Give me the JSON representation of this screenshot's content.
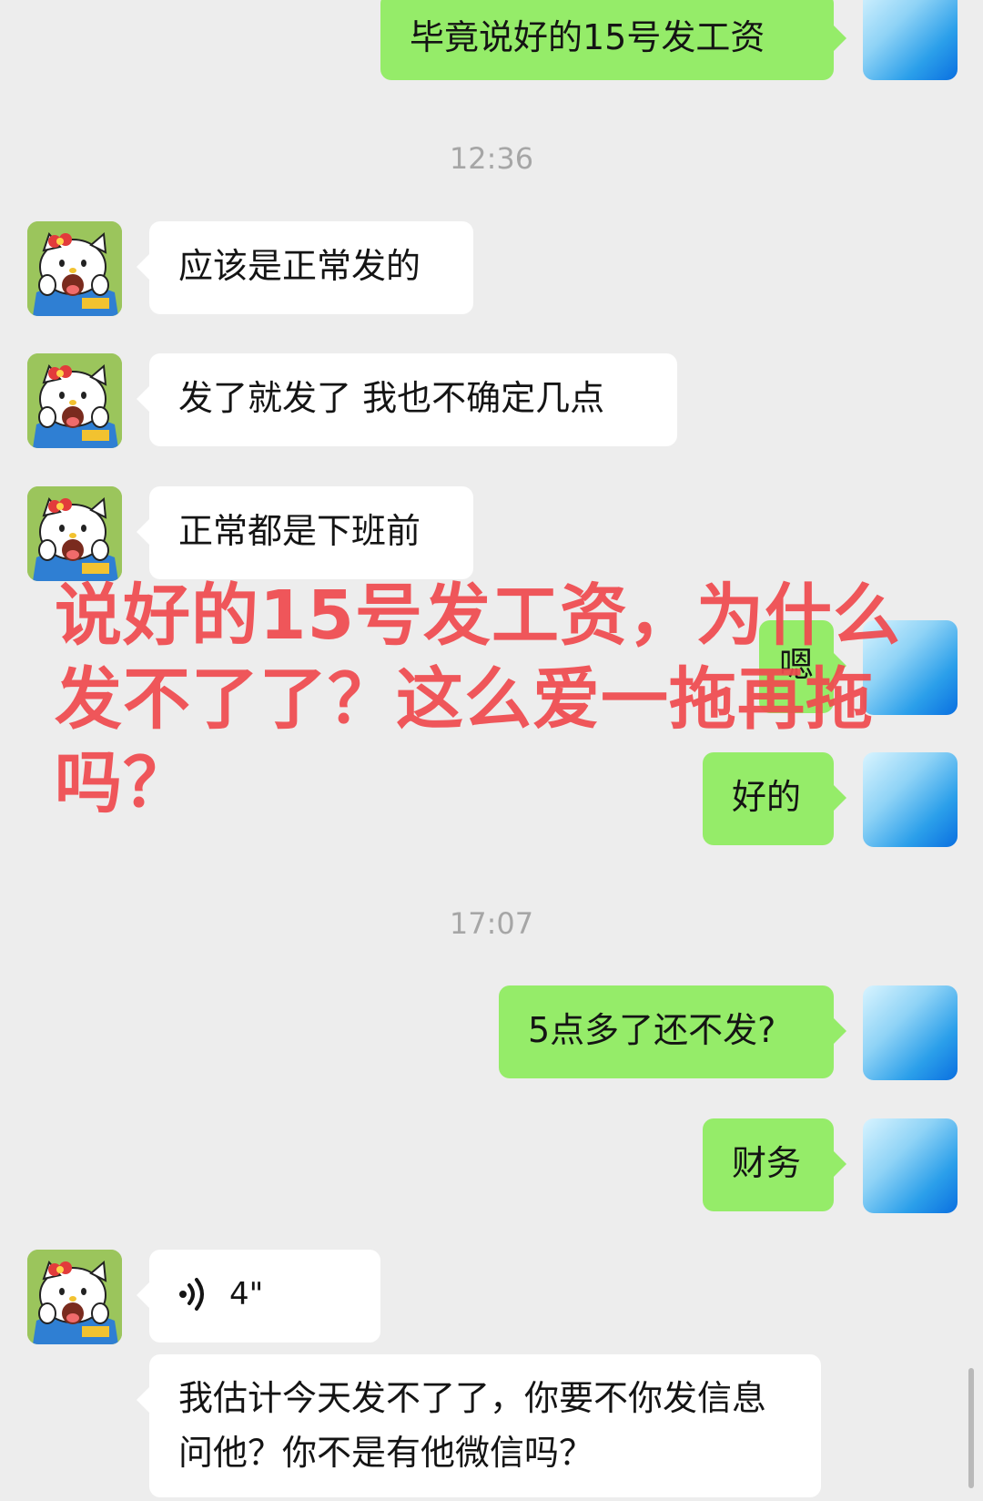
{
  "messages": {
    "m1": "毕竟说好的15号发工资",
    "t1": "12:36",
    "m2": "应该是正常发的",
    "m3": "发了就发了 我也不确定几点",
    "m4": "正常都是下班前",
    "m5": "嗯",
    "m6": "好的",
    "t2": "17:07",
    "m7": "5点多了还不发?",
    "m8": "财务",
    "voice_duration": "4\"",
    "m9": "我估计今天发不了了，你要不你发信息问他？你不是有他微信吗？"
  },
  "overlay_text": "说好的15号发工资，为什么发不了了？这么爱一拖再拖吗？",
  "colors": {
    "background": "#ededed",
    "outgoing_bubble": "#95ec69",
    "incoming_bubble": "#ffffff",
    "overlay_text": "#f04b4f",
    "timestamp": "#a6a6a6"
  },
  "icons": {
    "contact_avatar": "hello-kitty-avatar",
    "self_avatar": "blue-gradient-avatar",
    "voice": "voice-wave-icon"
  }
}
